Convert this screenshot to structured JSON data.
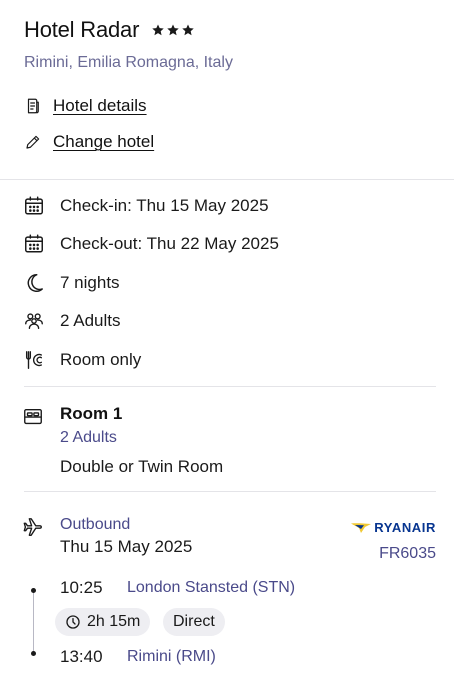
{
  "hotel": {
    "name": "Hotel Radar",
    "star_rating": 3,
    "location": "Rimini, Emilia Romagna, Italy",
    "links": {
      "details": "Hotel details",
      "change": "Change hotel"
    }
  },
  "stay": {
    "check_in": "Check-in: Thu 15 May 2025",
    "check_out": "Check-out: Thu 22 May 2025",
    "nights": "7 nights",
    "guests": "2 Adults",
    "board": "Room only"
  },
  "room": {
    "title": "Room 1",
    "guests": "2 Adults",
    "type": "Double or Twin Room"
  },
  "flight": {
    "direction": "Outbound",
    "date": "Thu 15 May 2025",
    "airline": "RYANAIR",
    "number": "FR6035",
    "departure": {
      "time": "10:25",
      "airport": "London Stansted (STN)"
    },
    "duration": "2h 15m",
    "stops": "Direct",
    "arrival": {
      "time": "13:40",
      "airport": "Rimini (RMI)"
    }
  },
  "icons": {
    "star": "star-icon",
    "details": "document-icon",
    "change": "pencil-icon",
    "check_in": "calendar-icon",
    "check_out": "calendar-icon",
    "nights": "moon-icon",
    "guests": "people-icon",
    "board": "cutlery-icon",
    "room": "bed-icon",
    "flight": "plane-icon",
    "duration": "clock-icon"
  },
  "colors": {
    "text": "#1a1a1a",
    "muted": "#4a4a8a",
    "location": "#6b6b96",
    "divider": "#e4e4e8",
    "chip_bg": "#eeeef2",
    "ryanair_blue": "#073590",
    "ryanair_gold": "#f1c933"
  }
}
